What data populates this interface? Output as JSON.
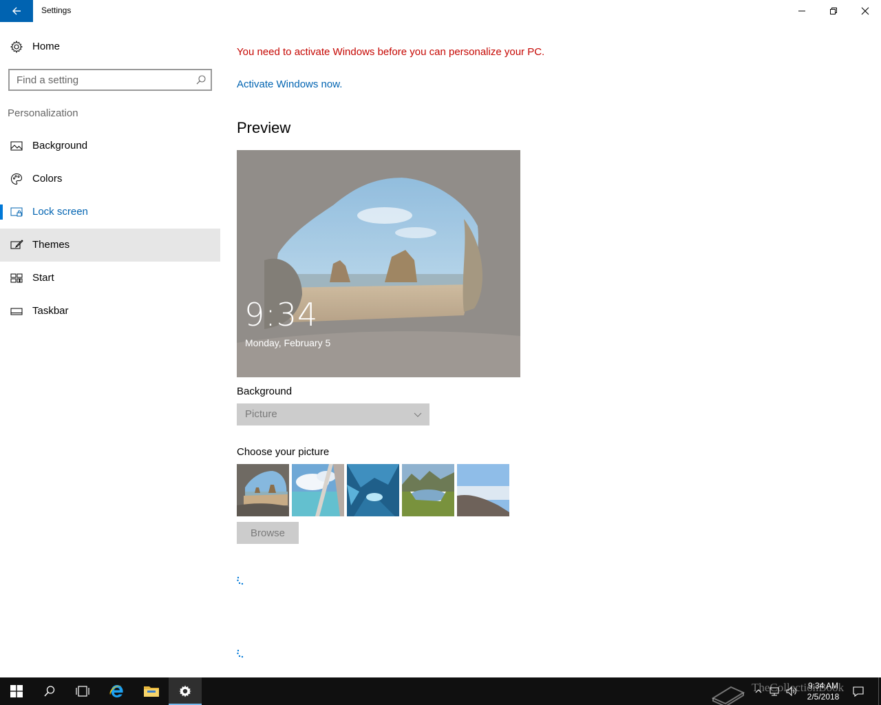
{
  "window": {
    "title": "Settings"
  },
  "sidebar": {
    "home_label": "Home",
    "search_placeholder": "Find a setting",
    "section_title": "Personalization",
    "items": [
      {
        "label": "Background",
        "icon": "picture-icon",
        "state": "normal"
      },
      {
        "label": "Colors",
        "icon": "palette-icon",
        "state": "normal"
      },
      {
        "label": "Lock screen",
        "icon": "lock-screen-icon",
        "state": "selected"
      },
      {
        "label": "Themes",
        "icon": "brush-icon",
        "state": "hover"
      },
      {
        "label": "Start",
        "icon": "start-tiles-icon",
        "state": "normal"
      },
      {
        "label": "Taskbar",
        "icon": "taskbar-icon",
        "state": "normal"
      }
    ]
  },
  "main": {
    "activation_message": "You need to activate Windows before you can personalize your PC.",
    "activate_link": "Activate Windows now.",
    "preview_title": "Preview",
    "lock_time": "9:34",
    "lock_date": "Monday, February 5",
    "background_label": "Background",
    "background_value": "Picture",
    "choose_picture_label": "Choose your picture",
    "browse_label": "Browse"
  },
  "taskbar": {
    "clock_time": "9:34 AM",
    "clock_date": "2/5/2018",
    "watermark": "TheCollectionBook"
  },
  "colors": {
    "accent": "#0078d7",
    "link": "#0063b1",
    "warning": "#c50500",
    "taskbar": "#101010"
  }
}
